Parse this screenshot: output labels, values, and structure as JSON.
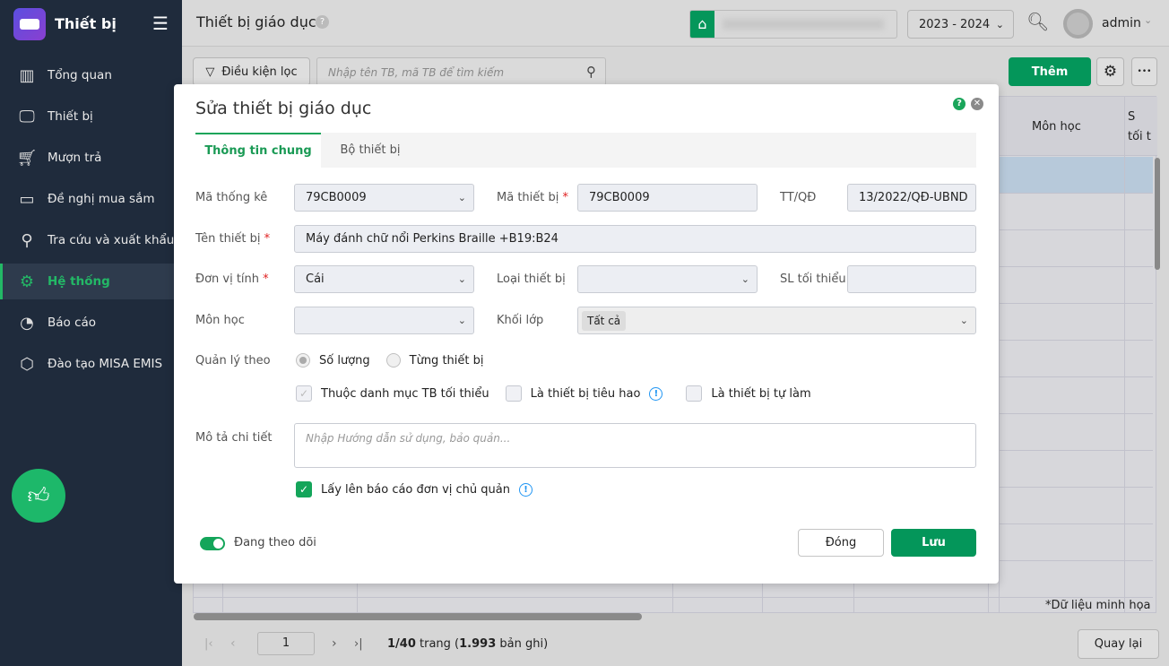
{
  "sidebar": {
    "app_title": "Thiết bị",
    "items": [
      {
        "label": "Tổng quan",
        "icon": "bar-chart-icon"
      },
      {
        "label": "Thiết bị",
        "icon": "monitor-icon"
      },
      {
        "label": "Mượn trả",
        "icon": "cart-icon"
      },
      {
        "label": "Đề nghị mua sắm",
        "icon": "projector-icon"
      },
      {
        "label": "Tra cứu và xuất khẩu",
        "icon": "search-icon"
      },
      {
        "label": "Hệ thống",
        "icon": "gear-icon",
        "active": true
      },
      {
        "label": "Báo cáo",
        "icon": "pie-chart-icon"
      },
      {
        "label": "Đào tạo MISA EMIS",
        "icon": "cube-icon"
      }
    ]
  },
  "header": {
    "title": "Thiết bị giáo dục",
    "help": "?",
    "school_year": "2023 - 2024",
    "user": "admin"
  },
  "toolbar": {
    "filter_label": "Điều kiện lọc",
    "search_placeholder": "Nhập tên TB, mã TB để tìm kiếm",
    "add_label": "Thêm",
    "more": "•••"
  },
  "table": {
    "headers": [
      "Môn học",
      "S\ntối t"
    ],
    "note": "*Dữ liệu minh họa"
  },
  "pagination": {
    "page": "1",
    "page_info_bold": "1/40",
    "page_info_mid": " trang (",
    "records_bold": "1.993",
    "records_tail": " bản ghi)",
    "back_label": "Quay lại"
  },
  "modal": {
    "title": "Sửa thiết bị giáo dục",
    "tabs": [
      "Thông tin chung",
      "Bộ thiết bị"
    ],
    "fields": {
      "ma_thong_ke": {
        "label": "Mã thống kê",
        "value": "79CB0009"
      },
      "ma_thiet_bi": {
        "label": "Mã thiết bị",
        "value": "79CB0009"
      },
      "tt_qd": {
        "label": "TT/QĐ",
        "value": "13/2022/QĐ-UBND"
      },
      "ten_thiet_bi": {
        "label": "Tên thiết bị",
        "value": "Máy đánh chữ nổi Perkins Braille +B19:B24"
      },
      "don_vi_tinh": {
        "label": "Đơn vị tính",
        "value": "Cái"
      },
      "loai_thiet_bi": {
        "label": "Loại thiết bị",
        "value": ""
      },
      "sl_toi_thieu": {
        "label": "SL tối thiểu",
        "value": ""
      },
      "mon_hoc": {
        "label": "Môn học",
        "value": ""
      },
      "khoi_lop": {
        "label": "Khối lớp",
        "tag": "Tất cả"
      },
      "quan_ly_theo": {
        "label": "Quản lý theo",
        "options": [
          "Số lượng",
          "Từng thiết bị"
        ],
        "selected": "Số lượng"
      },
      "checks": [
        "Thuộc danh mục TB tối thiểu",
        "Là thiết bị tiêu hao",
        "Là thiết bị tự làm"
      ],
      "mo_ta": {
        "label": "Mô tả chi tiết",
        "placeholder": "Nhập Hướng dẫn sử dụng, bảo quản..."
      },
      "bao_cao": {
        "label": "Lấy lên báo cáo đơn vị chủ quản",
        "checked": true
      }
    },
    "toggle_label": "Đang theo dõi",
    "close_label": "Đóng",
    "save_label": "Lưu",
    "req": "*"
  },
  "colors": {
    "accent": "#04965a",
    "sidebar": "#1f2b3c",
    "info": "#2196f3"
  }
}
